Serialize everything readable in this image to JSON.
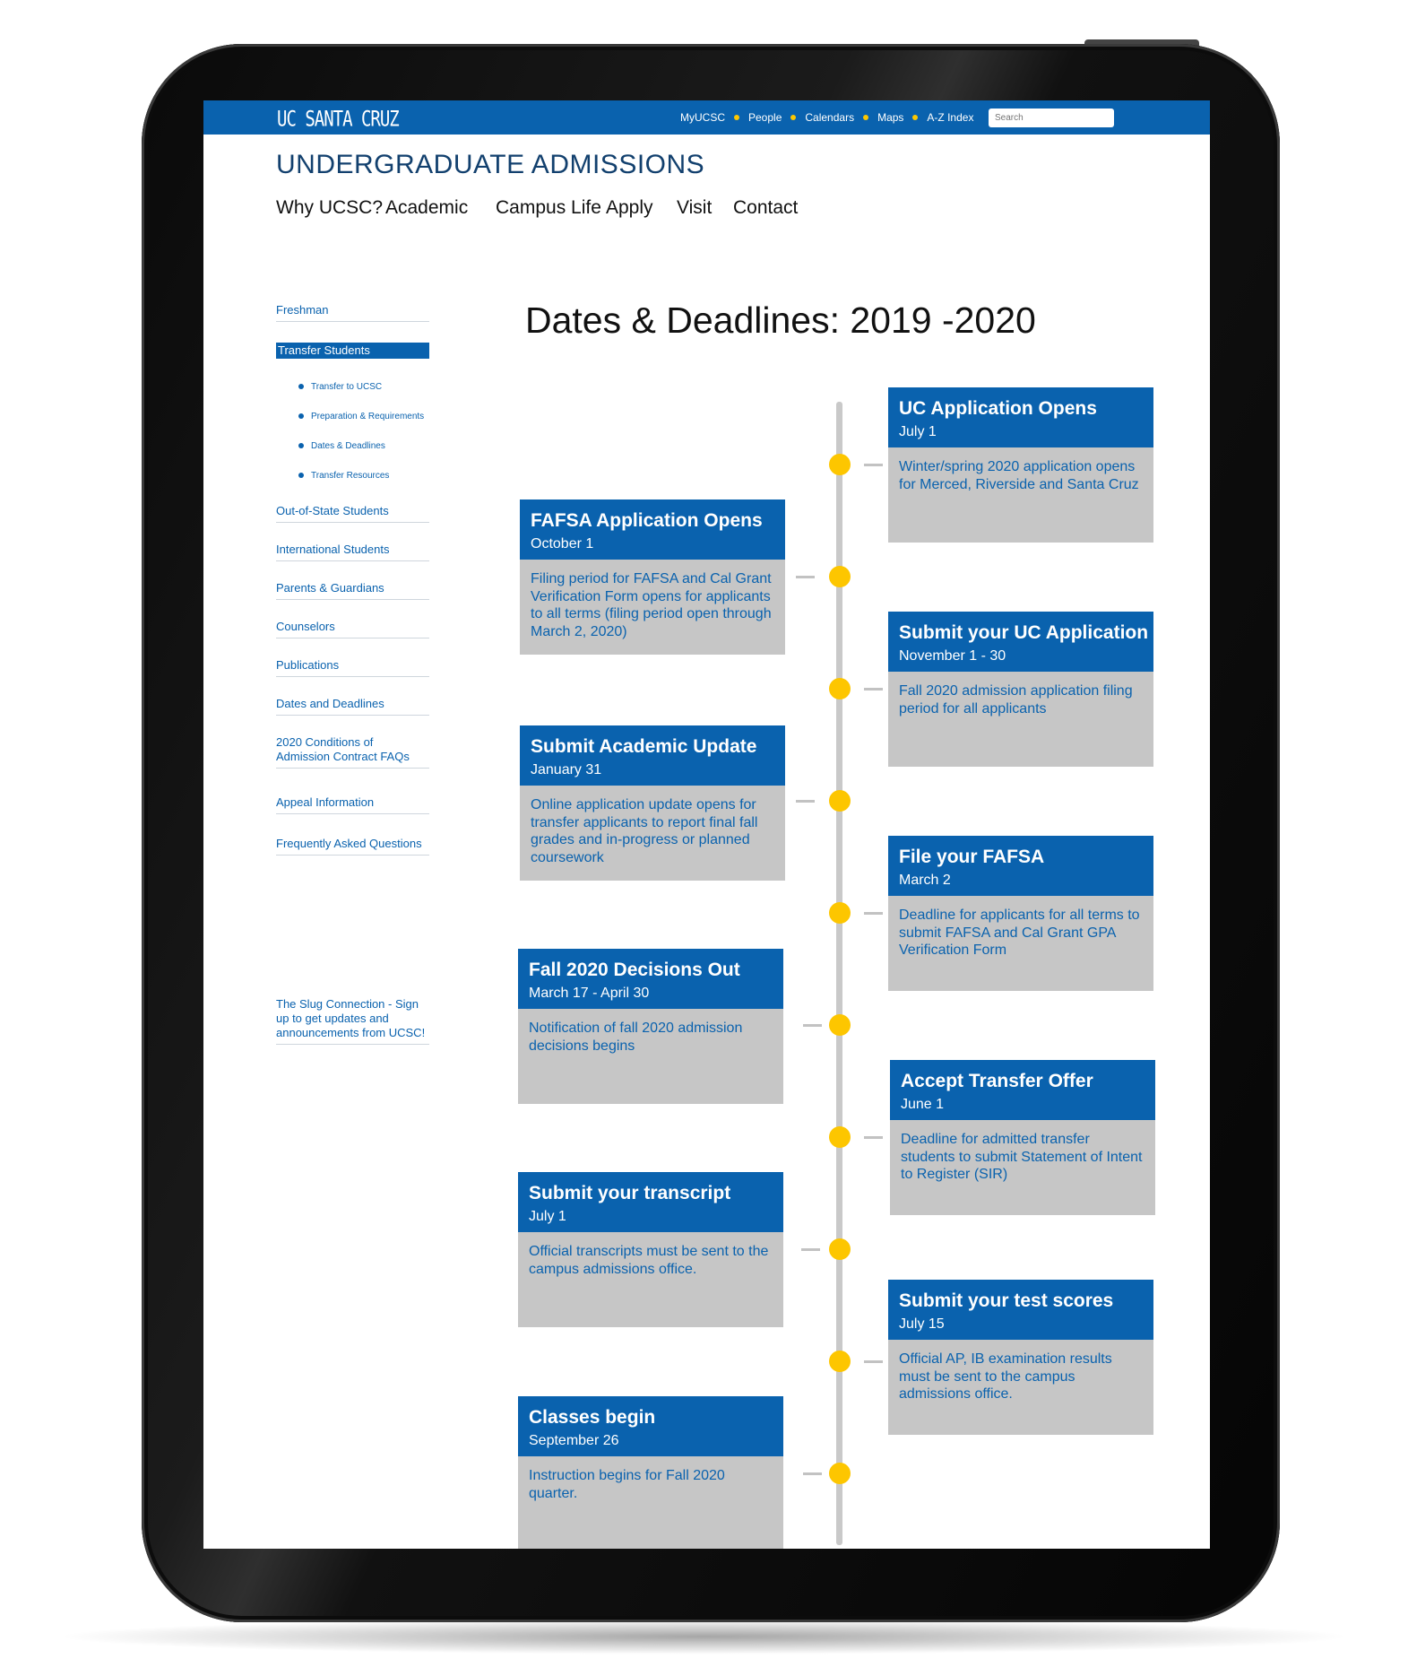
{
  "topbar": {
    "logo": "UC SANTA CRUZ",
    "links": [
      "MyUCSC",
      "People",
      "Calendars",
      "Maps",
      "A-Z Index"
    ],
    "search_placeholder": "Search"
  },
  "site_title": "UNDERGRADUATE ADMISSIONS",
  "main_nav": [
    "Why UCSC?",
    "Academic",
    "Campus Life",
    "Apply",
    "Visit",
    "Contact"
  ],
  "sidebar": {
    "items": [
      "Freshman",
      "Transfer Students"
    ],
    "sub_items": [
      "Transfer to UCSC",
      "Preparation & Requirements",
      "Dates & Deadlines",
      "Transfer Resources"
    ],
    "more_items": [
      "Out-of-State Students",
      "International Students",
      "Parents & Guardians",
      "Counselors",
      "Publications",
      "Dates and Deadlines",
      "2020 Conditions of Admission Contract FAQs",
      "Appeal Information",
      "Frequently Asked Questions"
    ],
    "slug_connection": "The Slug Connection - Sign up to get updates and announcements from UCSC!"
  },
  "page_heading": "Dates & Deadlines: 2019 -2020",
  "timeline": [
    {
      "title": "UC Application Opens",
      "date": "July 1",
      "desc": "Winter/spring 2020 application opens for Merced, Riverside and Santa Cruz"
    },
    {
      "title": "FAFSA Application Opens",
      "date": "October 1",
      "desc": "Filing period for FAFSA and Cal Grant Verification Form opens for applicants to all terms (filing period open through March 2, 2020)"
    },
    {
      "title": "Submit your UC Application",
      "date": "November 1 - 30",
      "desc": "Fall 2020 admission application filing period for all applicants"
    },
    {
      "title": "Submit Academic Update",
      "date": "January 31",
      "desc": "Online application update opens for transfer applicants to report final fall grades and in-progress or planned coursework"
    },
    {
      "title": "File your FAFSA",
      "date": "March 2",
      "desc": "Deadline for applicants for all terms to submit FAFSA and Cal Grant GPA Verification Form"
    },
    {
      "title": "Fall 2020 Decisions Out",
      "date": "March 17 - April 30",
      "desc": "Notification of fall 2020 admission decisions begins"
    },
    {
      "title": "Accept Transfer Offer",
      "date": "June 1",
      "desc": "Deadline for admitted transfer students to submit Statement of Intent to Register (SIR)"
    },
    {
      "title": "Submit your transcript",
      "date": "July 1",
      "desc": "Official transcripts must be sent to the campus admissions office."
    },
    {
      "title": "Submit your test scores",
      "date": "July 15",
      "desc": "Official AP, IB examination results must be sent to the campus admissions office."
    },
    {
      "title": "Classes begin",
      "date": "September 26",
      "desc": "Instruction begins for Fall 2020 quarter."
    }
  ],
  "colors": {
    "ucsc_blue": "#0a62ae",
    "gold": "#fdc600",
    "card_gray": "#c6c6c6",
    "title_navy": "#12406e"
  }
}
